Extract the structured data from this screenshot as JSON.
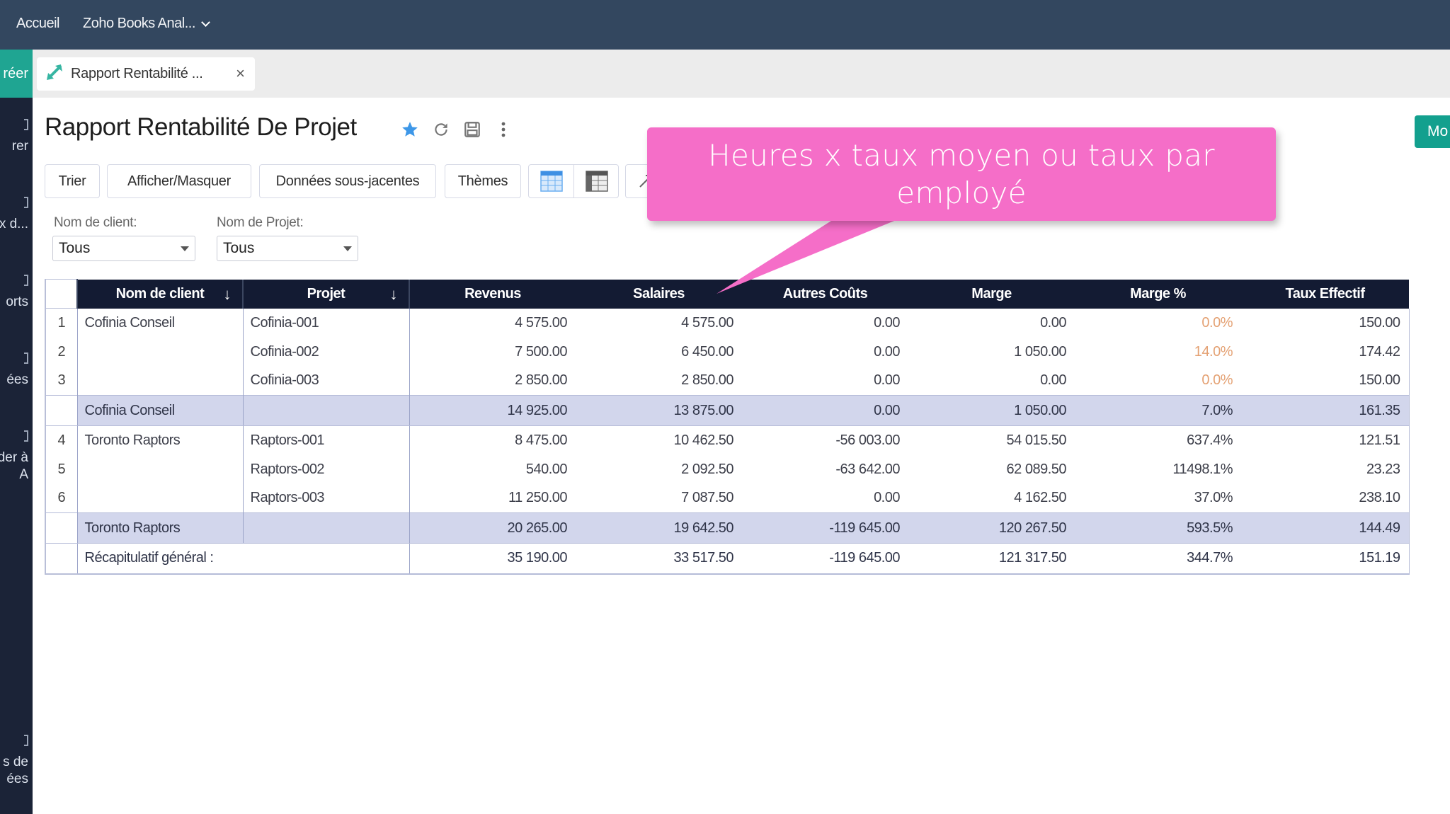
{
  "topbar": {
    "home": "Accueil",
    "workspace": "Zoho Books Anal..."
  },
  "sidebar": {
    "create_label": "réer",
    "items": [
      "rer",
      "x d...",
      "orts",
      "ées",
      "der à\nA",
      "s de\nées"
    ]
  },
  "tab": {
    "label": "Rapport Rentabilité ...",
    "close": "×"
  },
  "report": {
    "title": "Rapport Rentabilité De Projet",
    "right_button": "Mo"
  },
  "toolbar": {
    "sort": "Trier",
    "show_hide": "Afficher/Masquer",
    "underlying": "Données sous-jacentes",
    "themes": "Thèmes"
  },
  "filters": {
    "client_label": "Nom de client:",
    "client_value": "Tous",
    "project_label": "Nom de Projet:",
    "project_value": "Tous"
  },
  "table": {
    "columns": [
      "Nom de client",
      "Projet",
      "Revenus",
      "Salaires",
      "Autres Coûts",
      "Marge",
      "Marge %",
      "Taux Effectif"
    ],
    "sort_icon": "↓",
    "rows": [
      {
        "n": "1",
        "client": "Cofinia Conseil",
        "project": "Cofinia-001",
        "revenus": "4 575.00",
        "salaires": "4 575.00",
        "autres": "0.00",
        "marge": "0.00",
        "marge_pct": "0.0%",
        "taux": "150.00",
        "warn": true
      },
      {
        "n": "2",
        "client": "",
        "project": "Cofinia-002",
        "revenus": "7 500.00",
        "salaires": "6 450.00",
        "autres": "0.00",
        "marge": "1 050.00",
        "marge_pct": "14.0%",
        "taux": "174.42",
        "warn": true
      },
      {
        "n": "3",
        "client": "",
        "project": "Cofinia-003",
        "revenus": "2 850.00",
        "salaires": "2 850.00",
        "autres": "0.00",
        "marge": "0.00",
        "marge_pct": "0.0%",
        "taux": "150.00",
        "warn": true
      },
      {
        "subtotal": true,
        "client": "Cofinia Conseil",
        "revenus": "14 925.00",
        "salaires": "13 875.00",
        "autres": "0.00",
        "marge": "1 050.00",
        "marge_pct": "7.0%",
        "taux": "161.35"
      },
      {
        "n": "4",
        "client": "Toronto Raptors",
        "project": "Raptors-001",
        "revenus": "8 475.00",
        "salaires": "10 462.50",
        "autres": "-56 003.00",
        "marge": "54 015.50",
        "marge_pct": "637.4%",
        "taux": "121.51"
      },
      {
        "n": "5",
        "client": "",
        "project": "Raptors-002",
        "revenus": "540.00",
        "salaires": "2 092.50",
        "autres": "-63 642.00",
        "marge": "62 089.50",
        "marge_pct": "11498.1%",
        "taux": "23.23"
      },
      {
        "n": "6",
        "client": "",
        "project": "Raptors-003",
        "revenus": "11 250.00",
        "salaires": "7 087.50",
        "autres": "0.00",
        "marge": "4 162.50",
        "marge_pct": "37.0%",
        "taux": "238.10"
      },
      {
        "subtotal": true,
        "client": "Toronto Raptors",
        "revenus": "20 265.00",
        "salaires": "19 642.50",
        "autres": "-119 645.00",
        "marge": "120 267.50",
        "marge_pct": "593.5%",
        "taux": "144.49"
      }
    ],
    "grand_total": {
      "label": "Récapitulatif général :",
      "revenus": "35 190.00",
      "salaires": "33 517.50",
      "autres": "-119 645.00",
      "marge": "121 317.50",
      "marge_pct": "344.7%",
      "taux": "151.19"
    }
  },
  "callout": {
    "line1": "Heures x taux moyen ou taux par",
    "line2": "employé",
    "color": "#f56ec8"
  },
  "colors": {
    "topbar": "#33475f",
    "sidebar": "#1b2337",
    "accent": "#1fa592",
    "header": "#131b33",
    "subtotal": "#d2d6ec",
    "warn": "#e4a173",
    "star": "#3d97e8"
  }
}
